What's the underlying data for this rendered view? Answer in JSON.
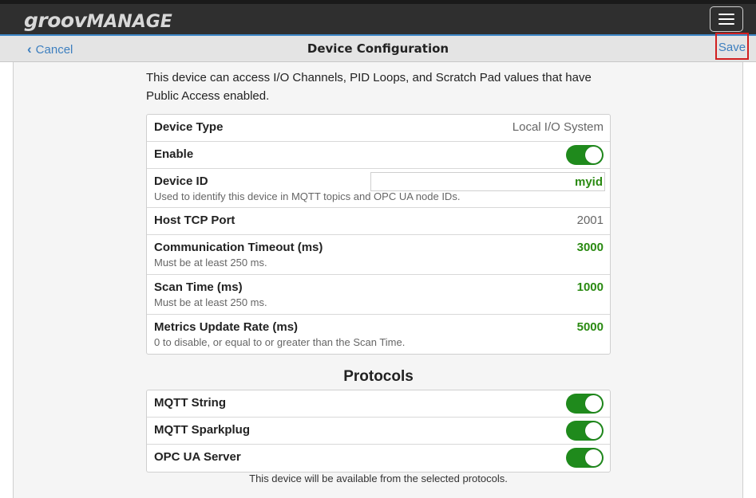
{
  "app": {
    "logo_groov": "groov",
    "logo_manage": "MANAGE"
  },
  "nav": {
    "cancel_label": "Cancel",
    "title": "Device Configuration",
    "save_label": "Save"
  },
  "intro_text": "This device can access I/O Channels, PID Loops, and Scratch Pad values that have Public Access enabled.",
  "settings": {
    "device_type": {
      "label": "Device Type",
      "value": "Local I/O System"
    },
    "enable": {
      "label": "Enable",
      "checked": true
    },
    "device_id": {
      "label": "Device ID",
      "value": "myid",
      "help": "Used to identify this device in MQTT topics and OPC UA node IDs."
    },
    "host_tcp_port": {
      "label": "Host TCP Port",
      "value": "2001"
    },
    "comm_timeout": {
      "label": "Communication Timeout (ms)",
      "value": "3000",
      "help": "Must be at least 250 ms."
    },
    "scan_time": {
      "label": "Scan Time (ms)",
      "value": "1000",
      "help": "Must be at least 250 ms."
    },
    "metrics_rate": {
      "label": "Metrics Update Rate (ms)",
      "value": "5000",
      "help": "0 to disable, or equal to or greater than the Scan Time."
    }
  },
  "protocols": {
    "title": "Protocols",
    "items": [
      {
        "label": "MQTT String",
        "checked": true
      },
      {
        "label": "MQTT Sparkplug",
        "checked": true
      },
      {
        "label": "OPC UA Server",
        "checked": true
      }
    ],
    "footnote": "This device will be available from the selected protocols."
  },
  "colors": {
    "accent": "#3d7fbf",
    "toggle_on": "#1f8a1c",
    "value_green": "#2a8a12",
    "highlight": "#d11f1f"
  }
}
